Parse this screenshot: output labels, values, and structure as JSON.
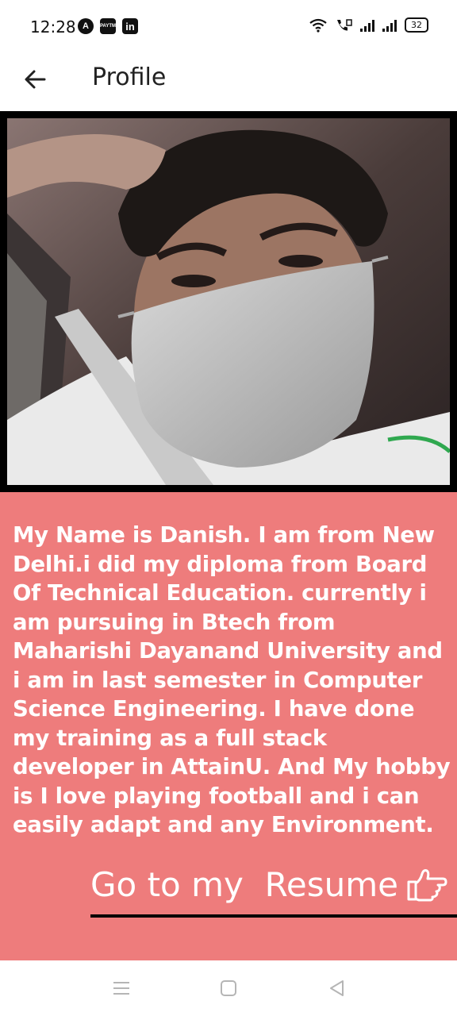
{
  "status_bar": {
    "time": "12:28",
    "app_icons": [
      "A",
      "PAYTM",
      "in"
    ],
    "battery": "32"
  },
  "header": {
    "title": "Profile",
    "back_icon": "arrow-left-icon"
  },
  "profile": {
    "bio": "My Name is Danish. I am from New Delhi.i did my diploma from Board Of Technical Education. currently i am pursuing in Btech from Maharishi Dayanand University and i am in last semester in Computer Science Engineering. I have done my training as a full stack developer in AttainU. And My hobby is I love playing football and i can easily adapt and any Environment.",
    "resume_link_label": "Go to my  Resume",
    "resume_icon": "hand-pointing-right-icon"
  },
  "colors": {
    "accent": "#ee7c7c",
    "photo_border": "#000000"
  },
  "nav": {
    "icons": [
      "menu-icon",
      "home-square-icon",
      "back-triangle-icon"
    ]
  }
}
